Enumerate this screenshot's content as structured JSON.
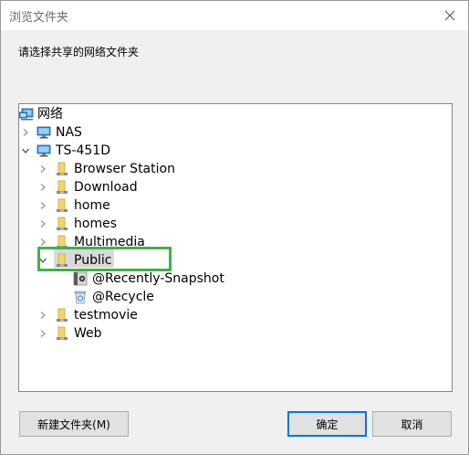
{
  "dialog": {
    "title": "浏览文件夹",
    "description": "请选择共享的网络文件夹"
  },
  "tree": {
    "root": "网络",
    "nas": "NAS",
    "server": "TS-451D",
    "folders": {
      "browser_station": "Browser Station",
      "download": "Download",
      "home": "home",
      "homes": "homes",
      "multimedia": "Multimedia",
      "public": "Public",
      "recently_snapshot": "@Recently-Snapshot",
      "recycle": "@Recycle",
      "testmovie": "testmovie",
      "web": "Web"
    }
  },
  "buttons": {
    "new_folder": "新建文件夹(M)",
    "ok": "确定",
    "cancel": "取消"
  },
  "colors": {
    "highlight_border": "#3cb34a",
    "selection_bg": "#d9d9d9",
    "folder_yellow": "#f5d46a"
  }
}
